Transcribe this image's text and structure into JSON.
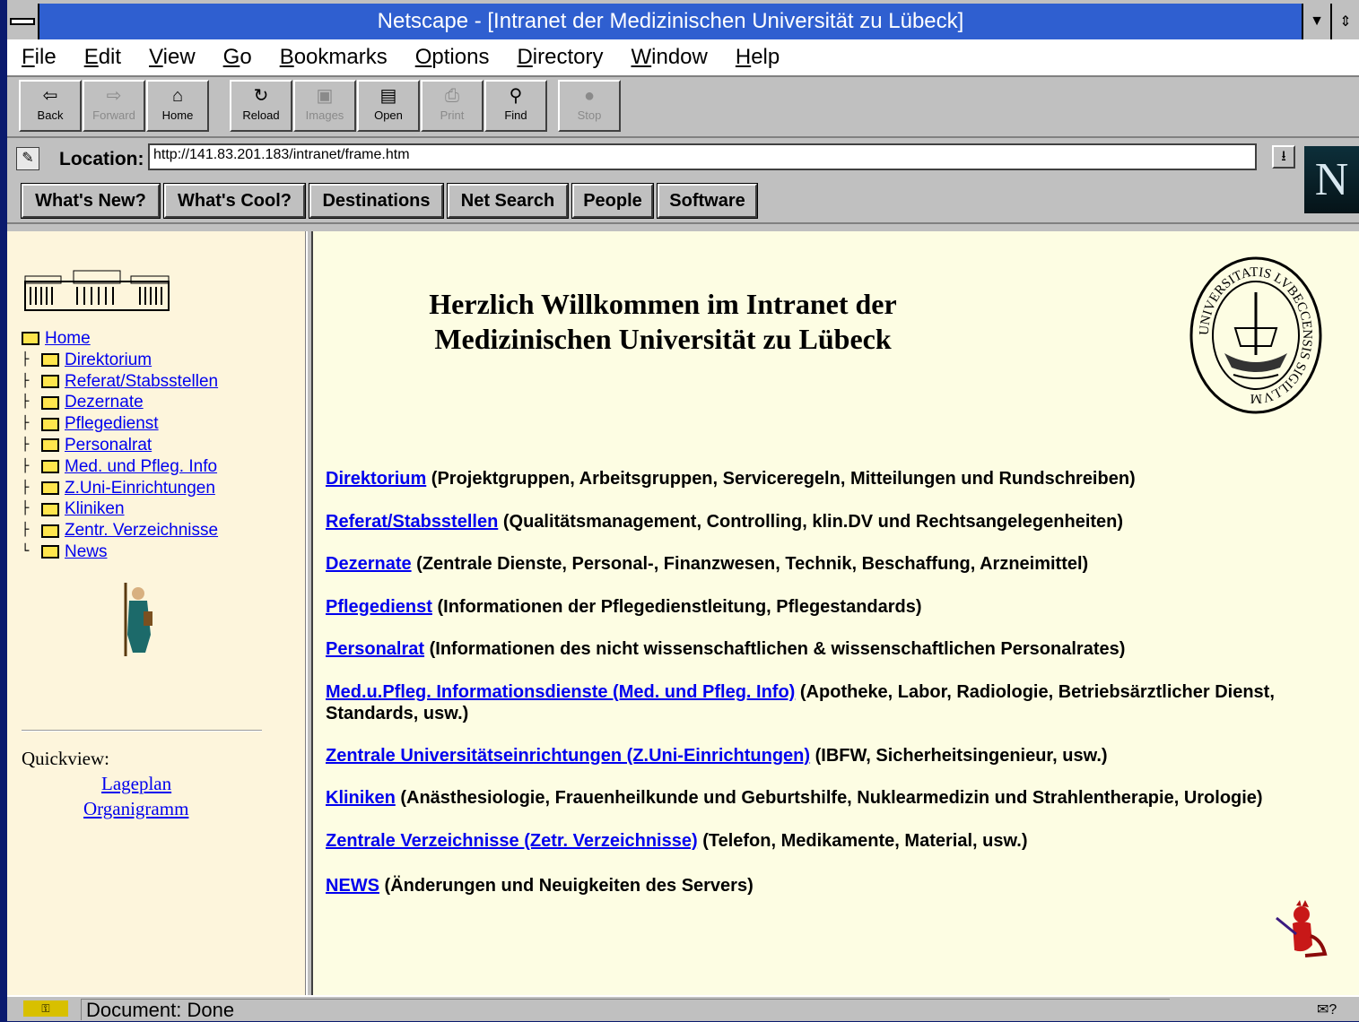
{
  "window": {
    "title": "Netscape - [Intranet der Medizinischen Universität zu Lübeck]"
  },
  "menu": [
    {
      "label": "File",
      "u": "F",
      "rest": "ile"
    },
    {
      "label": "Edit",
      "u": "E",
      "rest": "dit"
    },
    {
      "label": "View",
      "u": "V",
      "rest": "iew"
    },
    {
      "label": "Go",
      "u": "G",
      "rest": "o"
    },
    {
      "label": "Bookmarks",
      "u": "B",
      "rest": "ookmarks"
    },
    {
      "label": "Options",
      "u": "O",
      "rest": "ptions"
    },
    {
      "label": "Directory",
      "u": "D",
      "rest": "irectory"
    },
    {
      "label": "Window",
      "u": "W",
      "rest": "indow"
    },
    {
      "label": "Help",
      "u": "H",
      "rest": "elp"
    }
  ],
  "toolbar": {
    "back": "Back",
    "forward": "Forward",
    "home": "Home",
    "reload": "Reload",
    "images": "Images",
    "open": "Open",
    "print": "Print",
    "find": "Find",
    "stop": "Stop"
  },
  "location": {
    "label": "Location:",
    "url": "http://141.83.201.183/intranet/frame.htm"
  },
  "directory_buttons": {
    "whats_new": "What's New?",
    "whats_cool": "What's Cool?",
    "destinations": "Destinations",
    "net_search": "Net Search",
    "people": "People",
    "software": "Software"
  },
  "logo_letter": "N",
  "sidebar": {
    "home": "Home",
    "items": [
      "Direktorium",
      "Referat/Stabsstellen",
      "Dezernate",
      "Pflegedienst",
      "Personalrat",
      "Med. und Pfleg. Info",
      "Z.Uni-Einrichtungen",
      "Kliniken",
      "Zentr. Verzeichnisse",
      "News"
    ],
    "quickview_label": "Quickview:",
    "quick_links": [
      "Lageplan",
      "Organigramm"
    ]
  },
  "main": {
    "welcome_line1": "Herzlich Willkommen im Intranet der",
    "welcome_line2": "Medizinischen Universität zu Lübeck",
    "seal_text": "UNIVERSITATIS LVBECCENSIS SIGILLVM",
    "entries": [
      {
        "link": "Direktorium",
        "desc": " (Projektgruppen, Arbeitsgruppen, Serviceregeln, Mitteilungen und Rundschreiben)"
      },
      {
        "link": "Referat/Stabsstellen",
        "desc": " (Qualitätsmanagement, Controlling, klin.DV und Rechtsangelegenheiten)"
      },
      {
        "link": "Dezernate",
        "desc": " (Zentrale Dienste, Personal-, Finanzwesen, Technik, Beschaffung, Arzneimittel)"
      },
      {
        "link": "Pflegedienst",
        "desc": " (Informationen der Pflegedienstleitung, Pflegestandards)"
      },
      {
        "link": "Personalrat",
        "desc": " (Informationen des nicht wissenschaftlichen & wissenschaftlichen Personalrates)"
      },
      {
        "link": "Med.u.Pfleg. Informationsdienste (Med. und Pfleg. Info)",
        "desc": " (Apotheke, Labor, Radiologie, Betriebsärztlicher Dienst, Standards, usw.)"
      },
      {
        "link": "Zentrale Universitätseinrichtungen (Z.Uni-Einrichtungen)",
        "desc": " (IBFW, Sicherheitsingenieur, usw.)"
      },
      {
        "link": "Kliniken",
        "desc": " (Anästhesiologie, Frauenheilkunde und Geburtshilfe, Nuklearmedizin und Strahlentherapie, Urologie)"
      },
      {
        "link": "Zentrale Verzeichnisse (Zetr. Verzeichnisse)",
        "desc": " (Telefon, Medikamente, Material, usw.)"
      },
      {
        "link": "NEWS",
        "desc": " (Änderungen und Neuigkeiten des Servers)"
      }
    ]
  },
  "status": {
    "text": "Document: Done"
  },
  "colors": {
    "titlebar": "#2f5fd0",
    "link": "#0000ee",
    "left_bg": "#fdf5dc",
    "right_bg": "#fdfde3"
  }
}
